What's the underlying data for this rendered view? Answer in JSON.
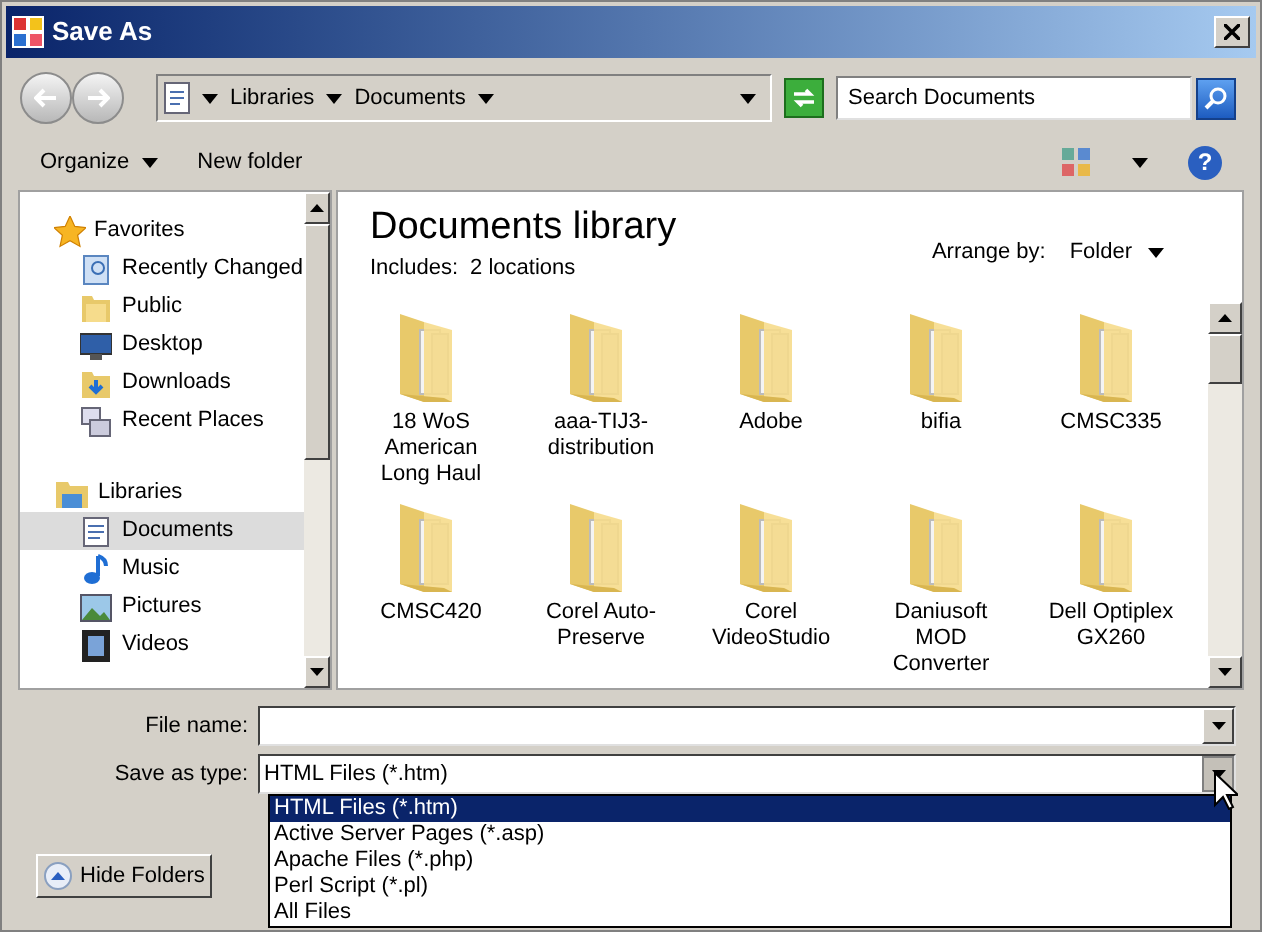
{
  "window": {
    "title": "Save As"
  },
  "address": {
    "crumbs": [
      "Libraries",
      "Documents"
    ]
  },
  "search": {
    "placeholder": "Search Documents"
  },
  "toolbar": {
    "organize": "Organize",
    "new_folder": "New folder",
    "help": "?"
  },
  "sidebar": {
    "sections": [
      {
        "label": "Favorites",
        "items": [
          {
            "label": "Recently Changed",
            "selected": false
          },
          {
            "label": "Public",
            "selected": false
          },
          {
            "label": "Desktop",
            "selected": false
          },
          {
            "label": "Downloads",
            "selected": false
          },
          {
            "label": "Recent Places",
            "selected": false
          }
        ]
      },
      {
        "label": "Libraries",
        "items": [
          {
            "label": "Documents",
            "selected": true
          },
          {
            "label": "Music",
            "selected": false
          },
          {
            "label": "Pictures",
            "selected": false
          },
          {
            "label": "Videos",
            "selected": false
          }
        ]
      }
    ]
  },
  "library": {
    "title": "Documents library",
    "includes_label": "Includes:",
    "includes_value": "2 locations",
    "arrange_label": "Arrange by:",
    "arrange_value": "Folder"
  },
  "folders": [
    {
      "name": "18 WoS American Long Haul"
    },
    {
      "name": "aaa-TIJ3-distribution"
    },
    {
      "name": "Adobe"
    },
    {
      "name": "bifia"
    },
    {
      "name": "CMSC335"
    },
    {
      "name": "CMSC420"
    },
    {
      "name": "Corel Auto-Preserve"
    },
    {
      "name": "Corel VideoStudio"
    },
    {
      "name": "Daniusoft MOD Converter"
    },
    {
      "name": "Dell Optiplex GX260"
    }
  ],
  "file_name": {
    "label": "File name:"
  },
  "save_type": {
    "label": "Save as type:",
    "value": "HTML Files (*.htm)",
    "expanded": true,
    "options": [
      {
        "label": "HTML Files (*.htm)",
        "selected": true
      },
      {
        "label": "Active Server Pages (*.asp)",
        "selected": false
      },
      {
        "label": "Apache Files (*.php)",
        "selected": false
      },
      {
        "label": "Perl Script (*.pl)",
        "selected": false
      },
      {
        "label": "All Files",
        "selected": false
      }
    ]
  },
  "hide_folders": "Hide Folders"
}
